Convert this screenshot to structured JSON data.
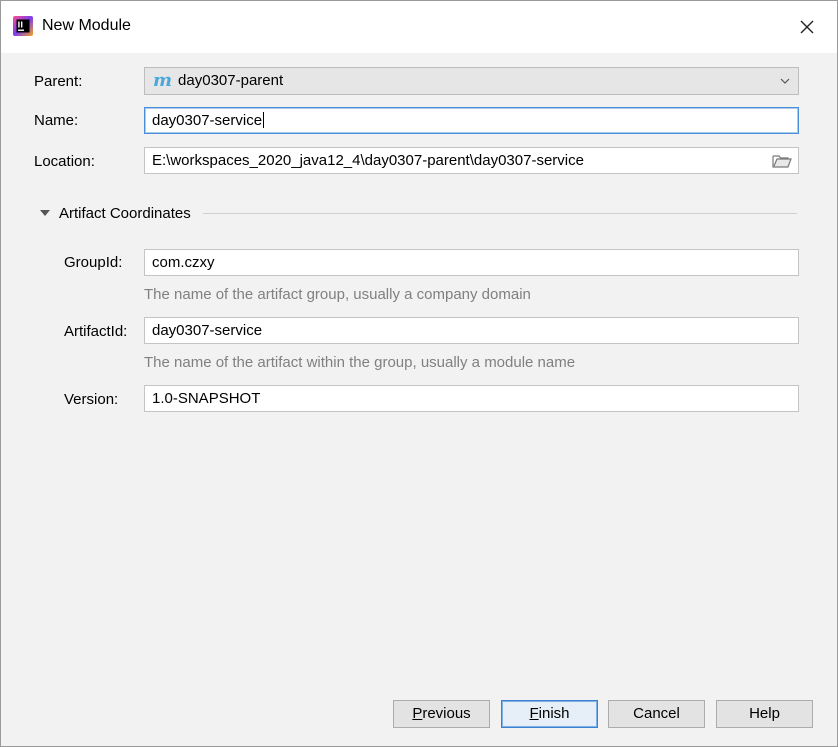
{
  "window": {
    "title": "New Module",
    "close_icon": "close-icon",
    "app_icon": "intellij-icon"
  },
  "form": {
    "parent": {
      "label": "Parent:",
      "value": "day0307-parent",
      "icon": "maven-module-icon"
    },
    "name": {
      "label": "Name:",
      "value": "day0307-service"
    },
    "location": {
      "label": "Location:",
      "value": "E:\\workspaces_2020_java12_4\\day0307-parent\\day0307-service",
      "icon": "folder-icon"
    }
  },
  "artifact": {
    "section_title": "Artifact Coordinates",
    "group_id": {
      "label": "GroupId:",
      "value": "com.czxy",
      "hint": "The name of the artifact group, usually a company domain"
    },
    "artifact_id": {
      "label": "ArtifactId:",
      "value": "day0307-service",
      "hint": "The name of the artifact within the group, usually a module name"
    },
    "version": {
      "label": "Version:",
      "value": "1.0-SNAPSHOT"
    }
  },
  "buttons": {
    "previous_mnemonic": "P",
    "previous_rest": "revious",
    "finish_mnemonic": "F",
    "finish_rest": "inish",
    "cancel": "Cancel",
    "help": "Help"
  },
  "colors": {
    "focus_border": "#4a8fd8",
    "maven_icon": "#4aa8dc",
    "hint_text": "#808080",
    "dialog_bg": "#f2f2f2"
  }
}
